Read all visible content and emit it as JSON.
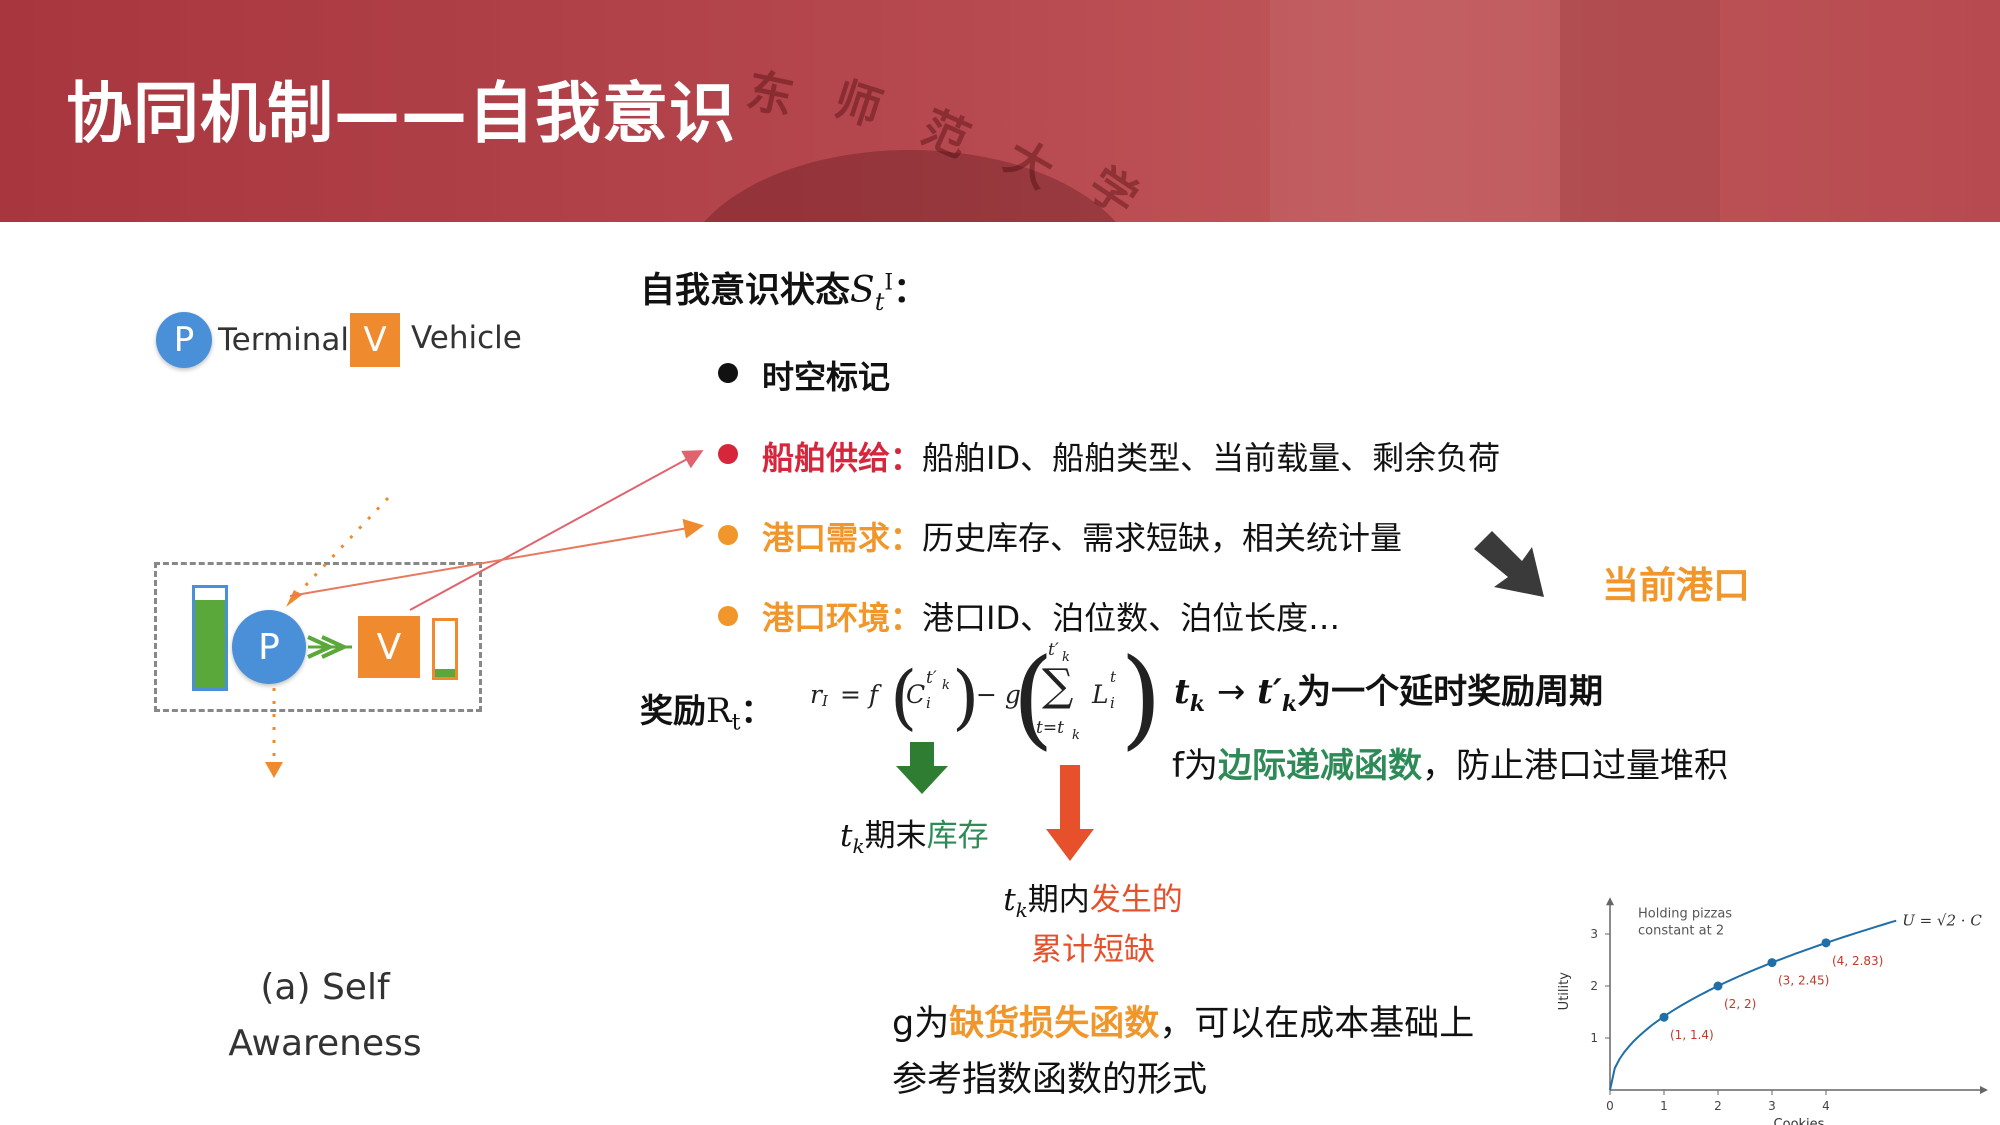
{
  "header": {
    "title": "协同机制——自我意识",
    "watermark_chars": [
      "东",
      "师",
      "范",
      "大",
      "学"
    ]
  },
  "left_figure": {
    "legend": {
      "terminal_glyph": "P",
      "terminal_label": "Terminal",
      "vehicle_glyph": "V",
      "vehicle_label": "Vehicle"
    },
    "node_terminal": "P",
    "node_vehicle": "V",
    "caption_line1": "(a) Self",
    "caption_line2": "Awareness",
    "colors": {
      "terminal": "#4a90d9",
      "vehicle": "#ef8a2e",
      "inventory": "#5aa83a"
    }
  },
  "state": {
    "title": "自我意识状态",
    "symbol": "S",
    "subscript": "t",
    "superscript": "I",
    "colon": "："
  },
  "bullets": [
    {
      "label": "时空标记",
      "detail": "",
      "color": "#111111"
    },
    {
      "label": "船舶供给：",
      "detail": "船舶ID、船舶类型、当前载量、剩余负荷",
      "color": "#d6263c"
    },
    {
      "label": "港口需求：",
      "detail": "历史库存、需求短缺，相关统计量",
      "color": "#f0962a"
    },
    {
      "label": "港口环境：",
      "detail": "港口ID、泊位数、泊位长度…",
      "color": "#f0962a"
    }
  ],
  "current_port_label": "当前港口",
  "reward": {
    "label": "奖励",
    "symbol": "R",
    "subscript": "t",
    "colon": "：",
    "formula": {
      "lhs": "r",
      "lhs_sub": "I",
      "eq": "= f",
      "c": "C",
      "c_sub": "i",
      "c_sup": "t′",
      "c_sup_sub": "k",
      "minus": "− g",
      "sum_top": "t′",
      "sum_top_sub": "k",
      "sum_bottom": "t=t",
      "sum_bottom_sub": "k",
      "l": "L",
      "l_sub": "i",
      "l_sup": "t",
      "comma": ","
    }
  },
  "period_note": {
    "from": "t",
    "from_sub": "k",
    "arrow": "→",
    "to": "t′",
    "to_sub": "k",
    "text": "为一个延时奖励周期"
  },
  "f_note": {
    "prefix": "f为",
    "highlight": "边际递减函数",
    "suffix": "，防止港口过量堆积",
    "highlight_color": "#2e8b57"
  },
  "inventory_label": {
    "t": "t",
    "t_sub": "k",
    "plain": "期末",
    "highlight": "库存",
    "highlight_color": "#2e8b57"
  },
  "shortage_label": {
    "t": "t",
    "t_sub": "k",
    "plain": "期内",
    "highlight1": "发生的",
    "highlight2": "累计短缺",
    "highlight_color": "#e6502a"
  },
  "g_note": {
    "prefix": "g为",
    "highlight": "缺货损失函数",
    "suffix": "，可以在成本基础上",
    "line2": "参考指数函数的形式",
    "highlight_color": "#f0962a"
  },
  "chart_data": {
    "type": "line",
    "title": "",
    "xlabel": "Cookies",
    "ylabel": "Utility",
    "annotation": [
      "Holding pizzas",
      "constant at 2"
    ],
    "equation_label": "U = √2 · C",
    "xlim": [
      0,
      5
    ],
    "ylim": [
      0,
      3.4
    ],
    "x_ticks": [
      "0",
      "1",
      "2",
      "3",
      "4"
    ],
    "y_ticks": [
      "1",
      "2",
      "3"
    ],
    "curve": {
      "formula": "sqrt(2*C)",
      "x_range": [
        0,
        5.3
      ]
    },
    "points": [
      {
        "x": 1,
        "y": 1.4,
        "label": "(1, 1.4)"
      },
      {
        "x": 2,
        "y": 2,
        "label": "(2, 2)"
      },
      {
        "x": 3,
        "y": 2.45,
        "label": "(3, 2.45)"
      },
      {
        "x": 4,
        "y": 2.83,
        "label": "(4, 2.83)"
      }
    ],
    "grid": false,
    "colors": {
      "line": "#1f6fa8",
      "point_label": "#c0392b"
    }
  }
}
